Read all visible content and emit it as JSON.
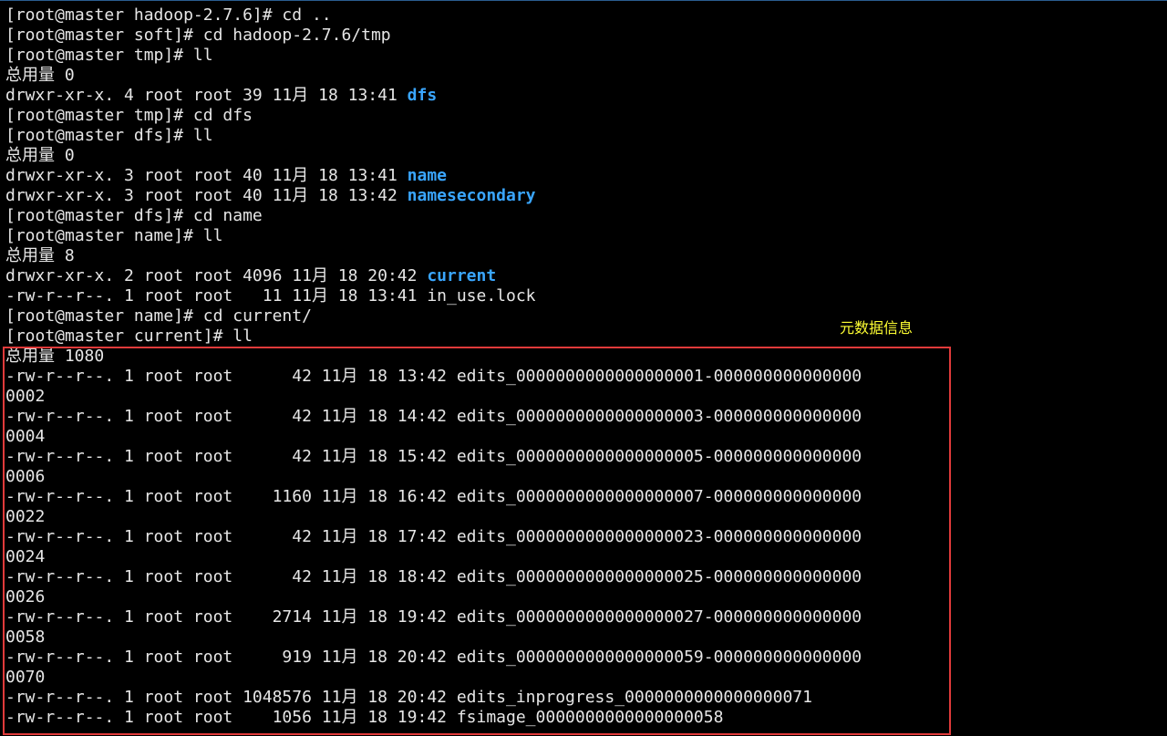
{
  "terminal": {
    "lines": [
      {
        "text": "[root@master hadoop-2.7.6]# cd ..",
        "link": ""
      },
      {
        "text": "[root@master soft]# cd hadoop-2.7.6/tmp",
        "link": ""
      },
      {
        "text": "[root@master tmp]# ll",
        "link": ""
      },
      {
        "text": "总用量 0",
        "link": ""
      },
      {
        "text": "drwxr-xr-x. 4 root root 39 11月 18 13:41 ",
        "link": "dfs"
      },
      {
        "text": "[root@master tmp]# cd dfs",
        "link": ""
      },
      {
        "text": "[root@master dfs]# ll",
        "link": ""
      },
      {
        "text": "总用量 0",
        "link": ""
      },
      {
        "text": "drwxr-xr-x. 3 root root 40 11月 18 13:41 ",
        "link": "name"
      },
      {
        "text": "drwxr-xr-x. 3 root root 40 11月 18 13:42 ",
        "link": "namesecondary"
      },
      {
        "text": "[root@master dfs]# cd name",
        "link": ""
      },
      {
        "text": "[root@master name]# ll",
        "link": ""
      },
      {
        "text": "总用量 8",
        "link": ""
      },
      {
        "text": "drwxr-xr-x. 2 root root 4096 11月 18 20:42 ",
        "link": "current"
      },
      {
        "text": "-rw-r--r--. 1 root root   11 11月 18 13:41 in_use.lock",
        "link": ""
      },
      {
        "text": "[root@master name]# cd current/",
        "link": ""
      },
      {
        "text": "[root@master current]# ll",
        "link": ""
      },
      {
        "text": "总用量 1080",
        "link": ""
      },
      {
        "text": "-rw-r--r--. 1 root root      42 11月 18 13:42 edits_0000000000000000001-000000000000000",
        "link": ""
      },
      {
        "text": "0002",
        "link": ""
      },
      {
        "text": "-rw-r--r--. 1 root root      42 11月 18 14:42 edits_0000000000000000003-000000000000000",
        "link": ""
      },
      {
        "text": "0004",
        "link": ""
      },
      {
        "text": "-rw-r--r--. 1 root root      42 11月 18 15:42 edits_0000000000000000005-000000000000000",
        "link": ""
      },
      {
        "text": "0006",
        "link": ""
      },
      {
        "text": "-rw-r--r--. 1 root root    1160 11月 18 16:42 edits_0000000000000000007-000000000000000",
        "link": ""
      },
      {
        "text": "0022",
        "link": ""
      },
      {
        "text": "-rw-r--r--. 1 root root      42 11月 18 17:42 edits_0000000000000000023-000000000000000",
        "link": ""
      },
      {
        "text": "0024",
        "link": ""
      },
      {
        "text": "-rw-r--r--. 1 root root      42 11月 18 18:42 edits_0000000000000000025-000000000000000",
        "link": ""
      },
      {
        "text": "0026",
        "link": ""
      },
      {
        "text": "-rw-r--r--. 1 root root    2714 11月 18 19:42 edits_0000000000000000027-000000000000000",
        "link": ""
      },
      {
        "text": "0058",
        "link": ""
      },
      {
        "text": "-rw-r--r--. 1 root root     919 11月 18 20:42 edits_0000000000000000059-000000000000000",
        "link": ""
      },
      {
        "text": "0070",
        "link": ""
      },
      {
        "text": "-rw-r--r--. 1 root root 1048576 11月 18 20:42 edits_inprogress_0000000000000000071",
        "link": ""
      },
      {
        "text": "-rw-r--r--. 1 root root    1056 11月 18 19:42 fsimage_0000000000000000058",
        "link": ""
      }
    ]
  },
  "annotation": {
    "label": "元数据信息"
  },
  "colors": {
    "background": "#000000",
    "text": "#e6e6e6",
    "directory": "#3aa6ff",
    "highlight_border": "#e03a3a",
    "annotation": "#ffff33"
  }
}
